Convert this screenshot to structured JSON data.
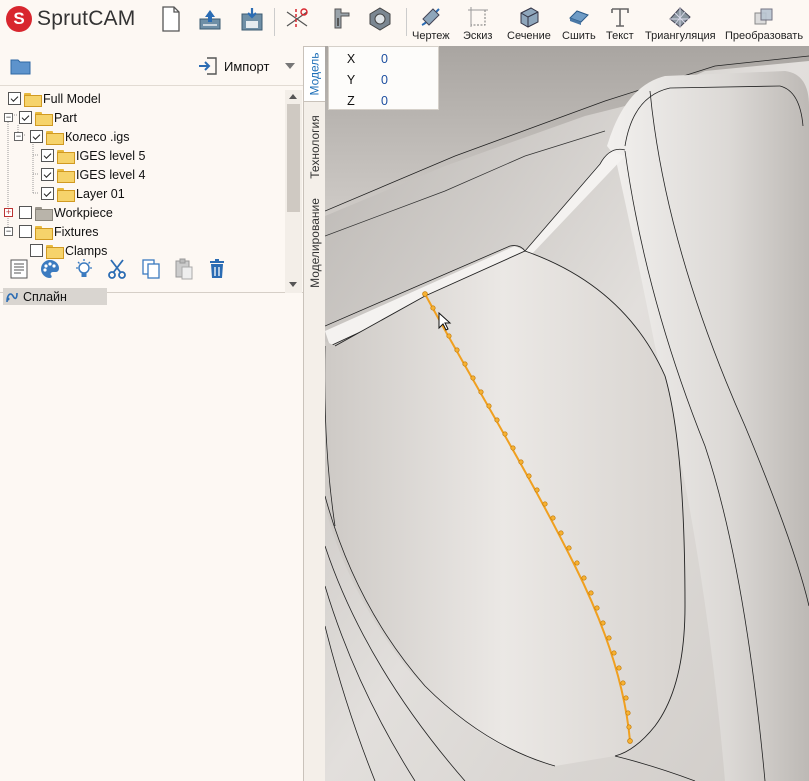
{
  "app": {
    "brand_letter": "S",
    "name": "SprutCAM"
  },
  "toolbar": {
    "buttons": [
      {
        "label": "Чертеж"
      },
      {
        "label": "Эскиз"
      },
      {
        "label": "Сечение"
      },
      {
        "label": "Сшить"
      },
      {
        "label": "Текст"
      },
      {
        "label": "Триангуляция"
      },
      {
        "label": "Преобразовать"
      }
    ]
  },
  "left_panel": {
    "import_label": "Импорт",
    "tree": [
      {
        "label": "Full Model",
        "checked": true
      },
      {
        "label": "Part",
        "checked": true
      },
      {
        "label": "Колесо .igs",
        "checked": true
      },
      {
        "label": "IGES level 5",
        "checked": true
      },
      {
        "label": "IGES level 4",
        "checked": true
      },
      {
        "label": "Layer 01",
        "checked": true
      },
      {
        "label": "Workpiece",
        "checked": false
      },
      {
        "label": "Fixtures",
        "checked": false
      },
      {
        "label": "Clamps",
        "checked": false
      }
    ],
    "selected_item": "Сплайн"
  },
  "side_tabs": [
    "Модель",
    "Технология",
    "Моделирование"
  ],
  "coordinates": [
    {
      "axis": "X",
      "value": "0"
    },
    {
      "axis": "Y",
      "value": "0"
    },
    {
      "axis": "Z",
      "value": "0"
    }
  ],
  "colors": {
    "spline": "#f0a020",
    "brand": "#d8262e",
    "accent": "#1d6fb8"
  }
}
